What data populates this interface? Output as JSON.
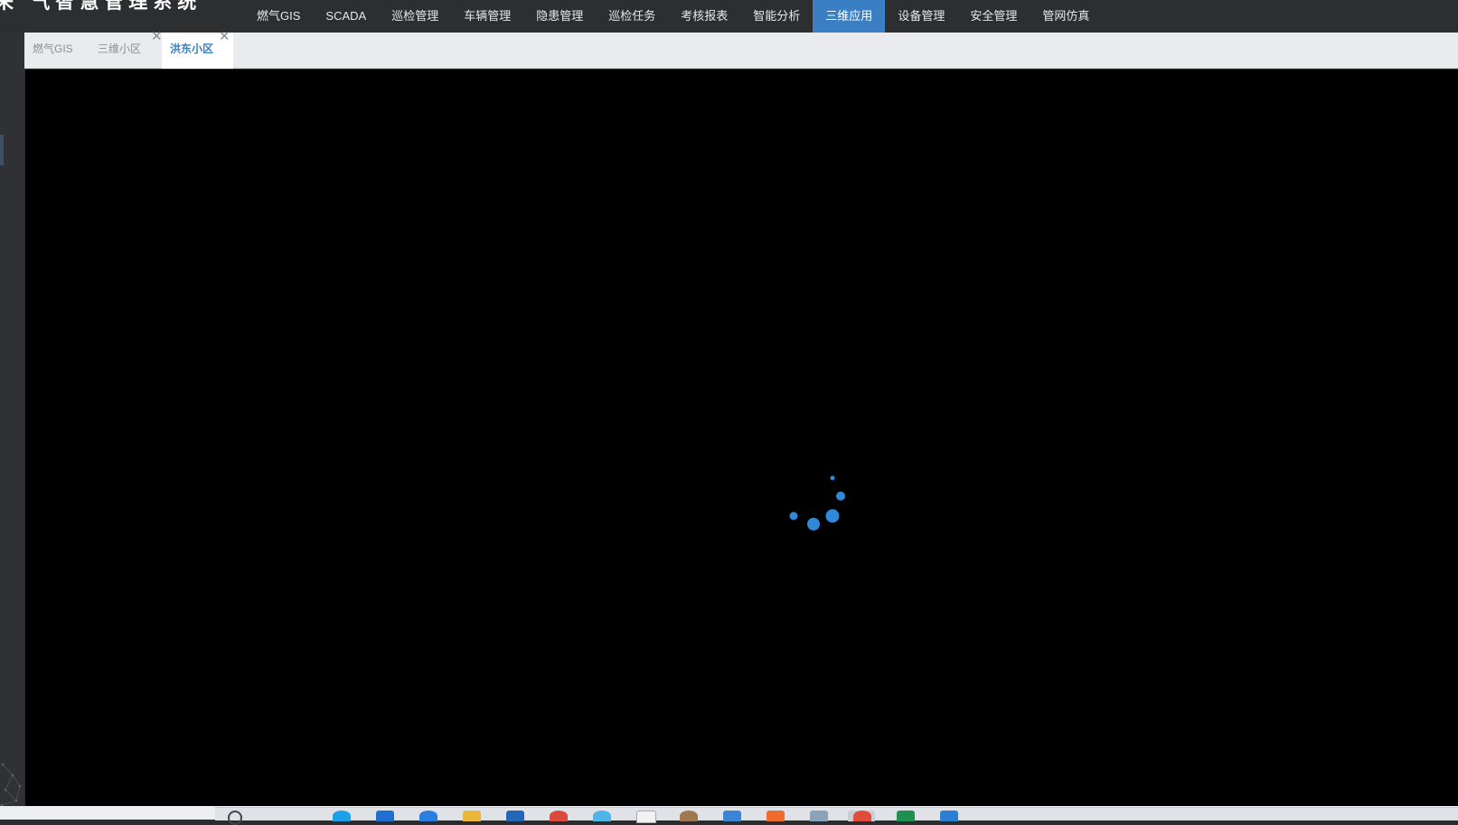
{
  "app": {
    "title": "来 气智慧管理系统"
  },
  "nav": {
    "items": [
      {
        "label": "燃气GIS"
      },
      {
        "label": "SCADA"
      },
      {
        "label": "巡检管理"
      },
      {
        "label": "车辆管理"
      },
      {
        "label": "隐患管理"
      },
      {
        "label": "巡检任务"
      },
      {
        "label": "考核报表"
      },
      {
        "label": "智能分析"
      },
      {
        "label": "三维应用",
        "active": true
      },
      {
        "label": "设备管理"
      },
      {
        "label": "安全管理"
      },
      {
        "label": "管网仿真"
      }
    ]
  },
  "tabs": [
    {
      "label": "燃气GIS",
      "closable": false
    },
    {
      "label": "三维小区",
      "closable": true,
      "close_glyph": "✕"
    },
    {
      "label": "洪东小区",
      "closable": true,
      "close_glyph": "✕",
      "active": true
    }
  ],
  "content": {
    "state": "loading",
    "spinner_color": "#2e8ad8"
  },
  "colors": {
    "topbar": "#2d2e30",
    "accent": "#3a7fc4",
    "tabbar": "#e9ebee",
    "viewport": "#000000"
  },
  "taskbar": {
    "icons": [
      "search-icon",
      "edge-icon",
      "store-icon",
      "browser-icon",
      "folder-icon",
      "app-icon",
      "chrome-icon",
      "globe-icon",
      "calendar-icon",
      "photo-icon",
      "monitor-icon",
      "orange-app-icon",
      "network-icon",
      "red-app-icon",
      "excel-icon",
      "vscode-icon"
    ]
  }
}
